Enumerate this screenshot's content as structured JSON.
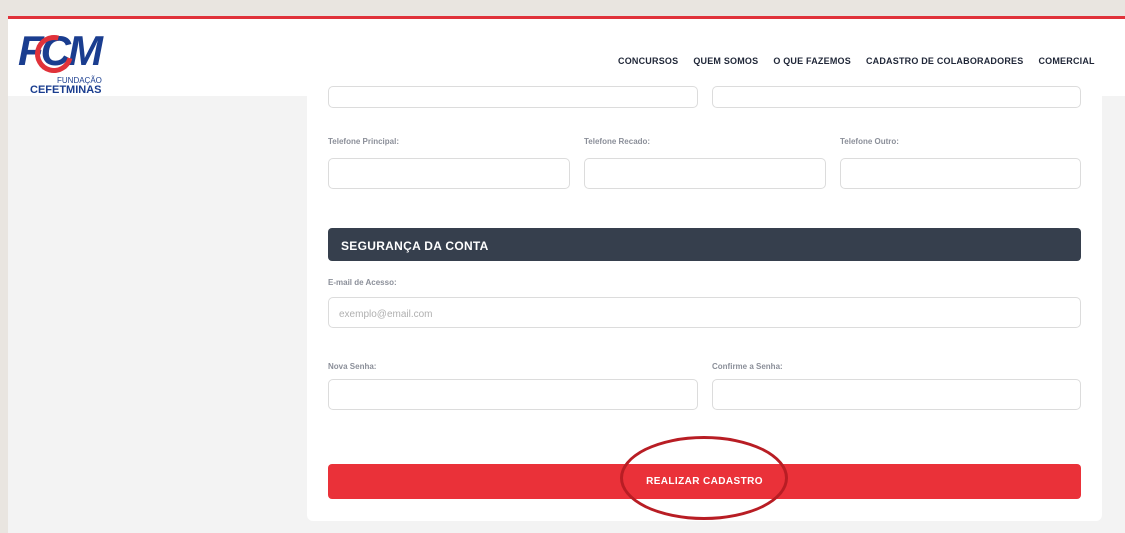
{
  "brand": {
    "logo_main": "FCM",
    "logo_sub1": "FUNDAÇÃO",
    "logo_sub2": "CEFETMINAS"
  },
  "nav": {
    "items": [
      "CONCURSOS",
      "QUEM SOMOS",
      "O QUE FAZEMOS",
      "CADASTRO DE COLABORADORES",
      "COMERCIAL"
    ]
  },
  "phones": {
    "principal_label": "Telefone Principal:",
    "recado_label": "Telefone Recado:",
    "outro_label": "Telefone Outro:"
  },
  "security": {
    "title": "SEGURANÇA DA CONTA",
    "email_label": "E-mail de Acesso:",
    "email_placeholder": "exemplo@email.com",
    "password_label": "Nova Senha:",
    "confirm_label": "Confirme a Senha:"
  },
  "submit_label": "REALIZAR CADASTRO",
  "colors": {
    "accent": "#ea3139",
    "brand_blue": "#1a3d8f",
    "section_bar": "#363f4d",
    "highlight_circle": "#b81d24"
  }
}
